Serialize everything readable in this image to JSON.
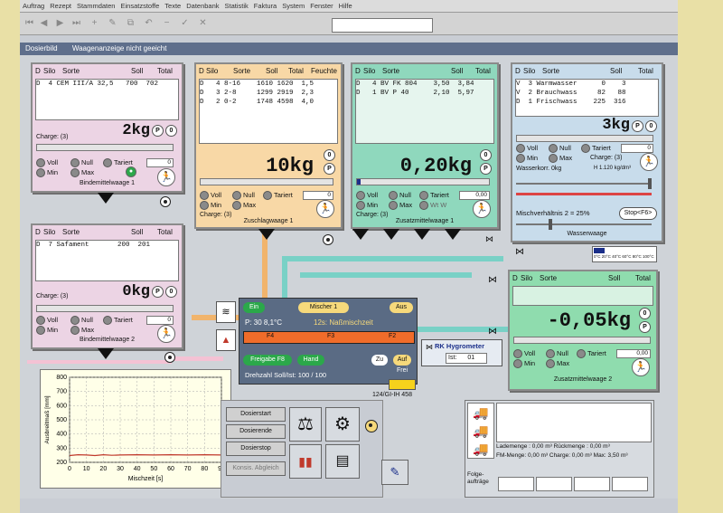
{
  "menu": [
    "Auftrag",
    "Rezept",
    "Stammdaten",
    "Einsatzstoffe",
    "Texte",
    "Datenbank",
    "Statistik",
    "Faktura",
    "System",
    "Fenster",
    "Hilfe"
  ],
  "tab": {
    "title": "Dosierbild",
    "warning": "Waagenanzeige nicht geeicht"
  },
  "colors": {
    "pink": "#ecd4e4",
    "peach": "#f8d8a6",
    "teal": "#8fd8bd",
    "blue": "#c8dceb",
    "green": "#8fdcae",
    "pipe_teal": "#79d1c6",
    "pipe_orange": "#f1b46c",
    "pipe_pink": "#f4c2d4"
  },
  "w1": {
    "header": [
      "D",
      "Silo",
      "Sorte",
      "Soll",
      "Total"
    ],
    "rows": [
      "D  4 CEM III/A 32,5   700  702"
    ],
    "kg": "2kg",
    "charge": "Charge: (3)",
    "value": "0",
    "title": "Bindemittelwaage 1"
  },
  "w2": {
    "header": [
      "D",
      "Silo",
      "Sorte",
      "Soll",
      "Total",
      "Feuchte"
    ],
    "rows": [
      "D   4 8-16    1610 1620  1,5",
      "D   3 2-8     1299 2919  2,3",
      "D   2 0-2     1748 4598  4,0"
    ],
    "kg": "10kg",
    "charge": "Charge: (3)",
    "value": "0",
    "title": "Zuschlagwaage 1"
  },
  "w3": {
    "header": [
      "D",
      "Silo",
      "Sorte",
      "Soll",
      "Total"
    ],
    "rows": [
      "D   4 BV FK 804    3,50  3,84",
      "D   1 BV P 40      2,10  5,97"
    ],
    "kg": "0,20kg",
    "charge": "Charge: (3)",
    "value": "0,00",
    "title": "Zusatzmittelwaage 1"
  },
  "w4": {
    "header": [
      "D",
      "Silo",
      "Sorte",
      "Soll",
      "Total"
    ],
    "rows": [
      "V  3 Warmwasser      0    3",
      "V  2 Brauchwass     82   88",
      "D  1 Frischwass    225  316"
    ],
    "kg": "3kg",
    "charge": "Charge: (3)",
    "value": "0",
    "korr": "Wasserkorr.",
    "korr_val": "0kg",
    "density": "H 1.120 kg/dm³",
    "ratio": "Mischverhältnis 2 = 25%",
    "stop": "Stop<F6>",
    "title": "Wasserwaage"
  },
  "w5": {
    "header": [
      "D",
      "Silo",
      "Sorte",
      "Soll",
      "Total"
    ],
    "rows": [
      "D  7 Safament       200  201"
    ],
    "kg": "0kg",
    "charge": "Charge: (3)",
    "value": "0",
    "title": "Bindemittelwaage 2"
  },
  "w6": {
    "header": [
      "D",
      "Silo",
      "Sorte",
      "Soll",
      "Total"
    ],
    "kg": "-0,05kg",
    "charge": "Charge: (3)",
    "value": "0,00",
    "title": "Zusatzmittelwaage 2"
  },
  "radio": {
    "voll": "Voll",
    "null": "Null",
    "tariert": "Tariert",
    "min": "Min",
    "max": "Max",
    "extra": "Wt W"
  },
  "p_btn": "P",
  "zero_btn": "0",
  "temp_scale": "0°C 20°C 40°C 60°C 80°C 100°C",
  "mixer": {
    "ein": "Ein",
    "mischer": "Mischer 1",
    "aus": "Aus",
    "status": "P: 30  8,1°C",
    "phase": "12s: Naßmischzeit",
    "seg1": "F4",
    "seg2": "F3",
    "seg3": "F2",
    "freigabe": "Freigabe F8",
    "hand": "Hand",
    "zu": "Zu",
    "auf": "Auf",
    "frei": "Frei",
    "drehzahl": "Drehzahl Soll/Ist:",
    "drehzahl_val": "100 / 100",
    "code": "124/GI-IH 458"
  },
  "hygro": {
    "title": "RK Hygrometer",
    "ist": "Ist:",
    "val": "01"
  },
  "buttons": {
    "start": "Dosierstart",
    "ende": "Dosierende",
    "stop": "Dosierstop",
    "abgleich": "Konsis. Abgleich"
  },
  "delivery": {
    "lademenge": "Lademenge : 0,00 m³  Rückmenge : 0,00 m³",
    "fm": "FM-Menge: 0,00 m³  Charge: 0,00 m³  Max: 3,50 m³",
    "folge": "Folge-\naufträge"
  },
  "chart_data": {
    "type": "line",
    "ylabel": "Ausbreitmaß [mm]",
    "xlabel": "Mischzeit [s]",
    "xlim": [
      0,
      90
    ],
    "ylim": [
      200,
      800
    ],
    "yticks": [
      800,
      700,
      600,
      500,
      400,
      300,
      200
    ],
    "xticks": [
      0,
      10,
      20,
      30,
      40,
      50,
      60,
      70,
      80,
      90
    ],
    "x": [
      0,
      5,
      10,
      15,
      20,
      25,
      30,
      40,
      50,
      60,
      70,
      80,
      90
    ],
    "y": [
      735,
      738,
      737,
      735,
      738,
      736,
      737,
      738,
      737,
      738,
      737,
      738,
      737
    ]
  }
}
